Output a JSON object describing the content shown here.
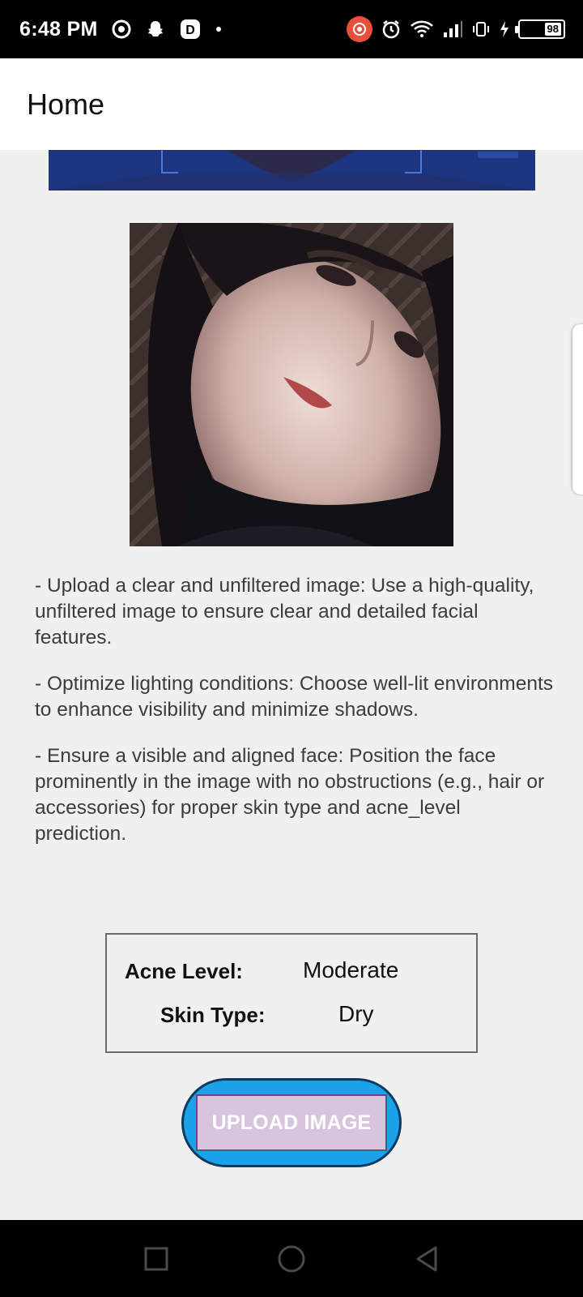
{
  "status_bar": {
    "time": "6:48 PM",
    "left_icons": [
      "screen-record-status-icon",
      "snapchat-icon",
      "app-d-icon",
      "dot-icon"
    ],
    "right_icons": [
      "recording-badge-icon",
      "alarm-icon",
      "wifi-icon",
      "signal-icon",
      "vibrate-icon",
      "charging-icon"
    ],
    "battery_level": "98"
  },
  "app_bar": {
    "title": "Home"
  },
  "instructions": [
    "- Upload a clear and unfiltered image: Use a high-quality, unfiltered image to ensure clear and detailed facial features.",
    "- Optimize lighting conditions: Choose well-lit environments to enhance visibility and minimize shadows.",
    "- Ensure a visible and aligned face: Position the face prominently in the image with no obstructions (e.g., hair or accessories) for proper skin type and acne_level prediction."
  ],
  "results": {
    "acne_label": "Acne Level:",
    "acne_value": "Moderate",
    "skin_label": "Skin Type:",
    "skin_value": "Dry"
  },
  "upload_button": {
    "label": "UPLOAD IMAGE"
  },
  "nav_bar": {
    "icons": [
      "recents-square-icon",
      "home-circle-icon",
      "back-triangle-icon"
    ]
  },
  "colors": {
    "accent_blue": "#1aa3ea",
    "button_fill": "#d8c4dc",
    "banner": "#243a8a",
    "background": "#f0f0f0"
  }
}
